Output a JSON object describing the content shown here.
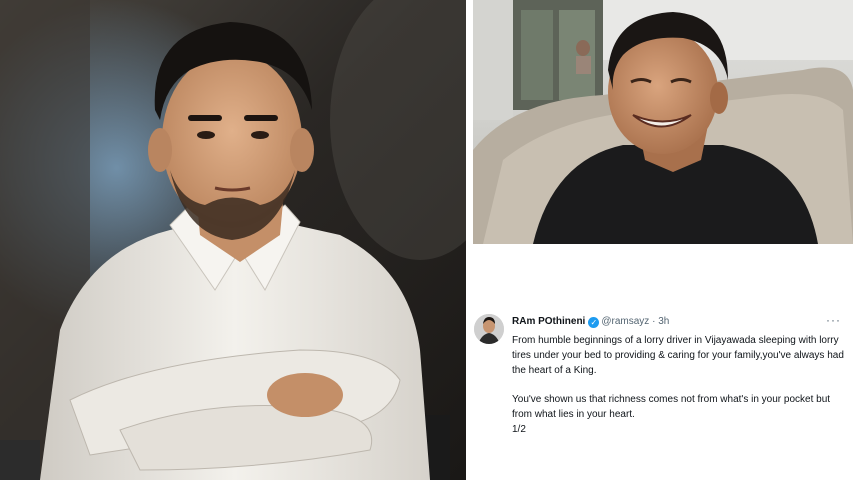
{
  "tweet": {
    "display_name": "RAm POthineni",
    "verified_icon": "verified-badge-icon",
    "handle": "@ramsayz",
    "separator": "·",
    "time": "3h",
    "paragraph_1": "From humble beginnings of a lorry driver in Vijayawada sleeping with lorry tires under your bed to providing & caring for your family,you've always had the heart of a King.",
    "paragraph_2": "You've shown us that richness comes not from what's in your pocket but from what lies in your heart.",
    "thread_count": "1/2"
  },
  "colors": {
    "name": "#0f1419",
    "meta": "#536471",
    "verified": "#1d9bf0"
  }
}
